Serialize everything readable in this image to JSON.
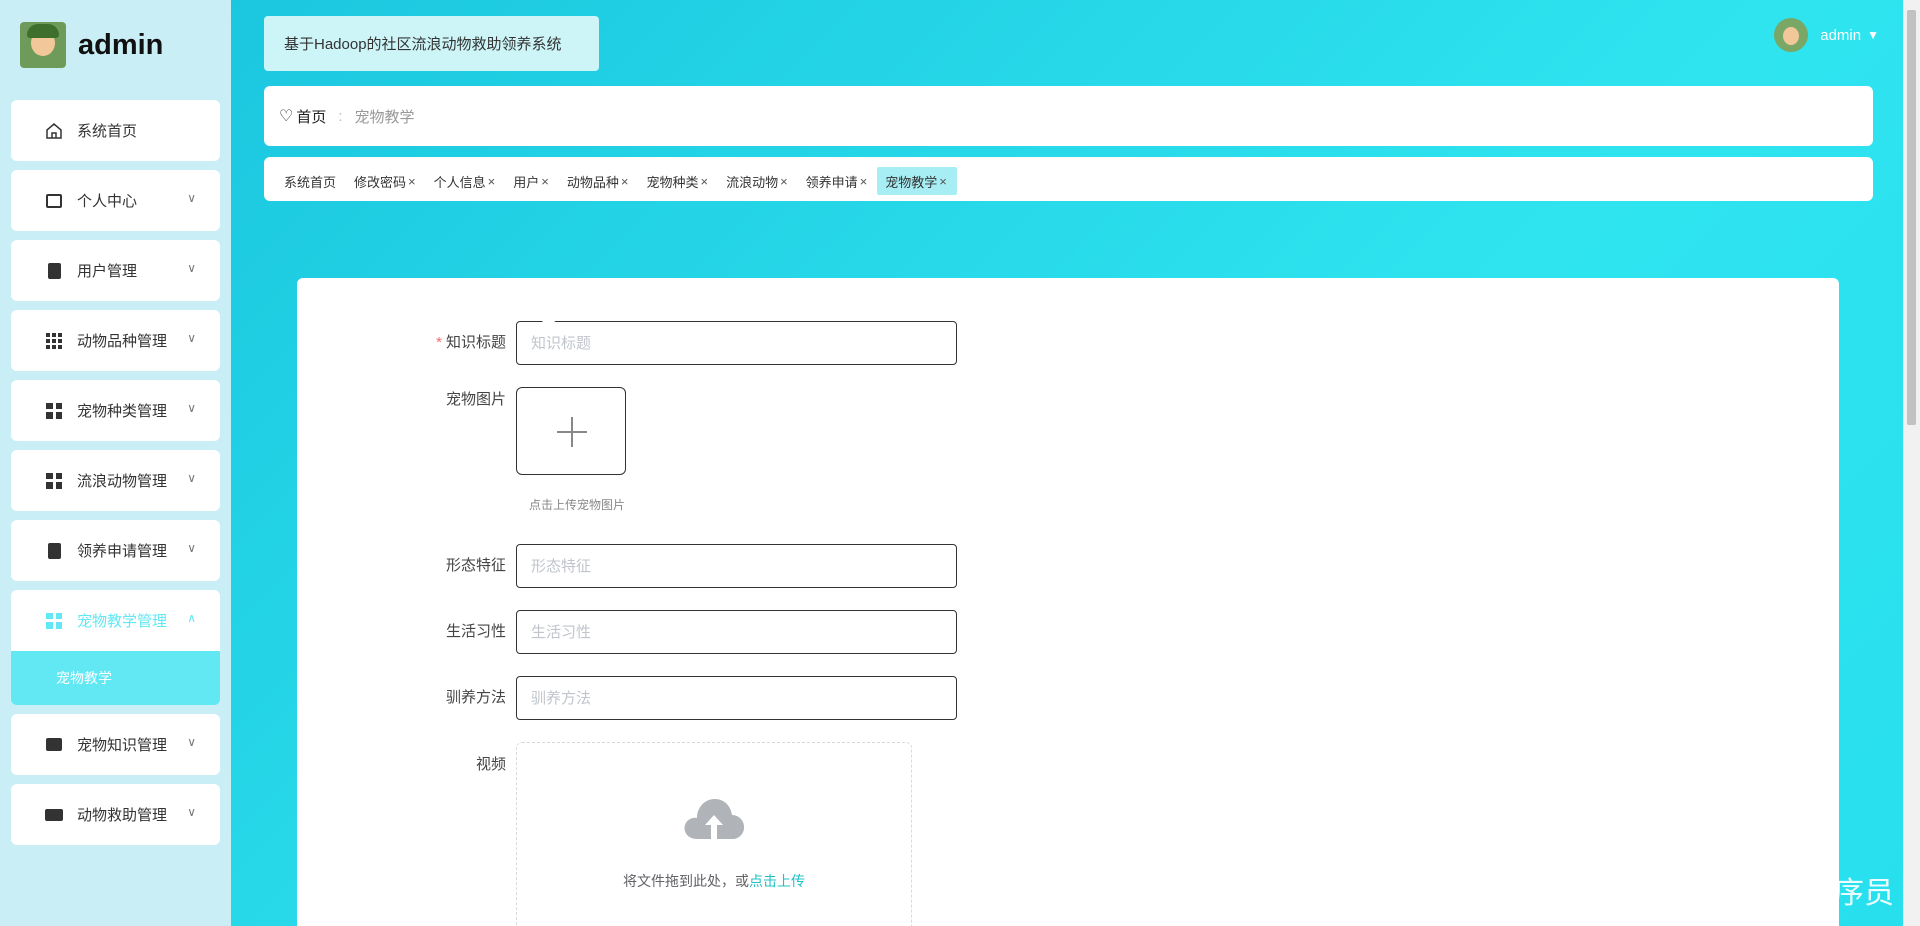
{
  "brand": {
    "name": "admin"
  },
  "sidebar": {
    "items": [
      {
        "label": "系统首页",
        "icon": "home-icon",
        "has_chevron": false
      },
      {
        "label": "个人中心",
        "icon": "card-icon",
        "has_chevron": true
      },
      {
        "label": "用户管理",
        "icon": "clipboard-icon",
        "has_chevron": true
      },
      {
        "label": "动物品种管理",
        "icon": "grid-icon",
        "has_chevron": true
      },
      {
        "label": "宠物种类管理",
        "icon": "grid-icon",
        "has_chevron": true
      },
      {
        "label": "流浪动物管理",
        "icon": "grid-icon",
        "has_chevron": true
      },
      {
        "label": "领养申请管理",
        "icon": "clipboard-icon",
        "has_chevron": true
      },
      {
        "label": "宠物教学管理",
        "icon": "grid-icon",
        "has_chevron": true,
        "active": true
      },
      {
        "label": "宠物知识管理",
        "icon": "wallet-icon",
        "has_chevron": true
      },
      {
        "label": "动物救助管理",
        "icon": "ticket-icon",
        "has_chevron": true
      }
    ],
    "submenu_active": "宠物教学",
    "active_color": "#62e8f3"
  },
  "header": {
    "system_title": "基于Hadoop的社区流浪动物救助领养系统",
    "user_name": "admin"
  },
  "breadcrumb": {
    "home": "首页",
    "current": "宠物教学"
  },
  "tabs": [
    {
      "label": "系统首页",
      "closable": false
    },
    {
      "label": "修改密码",
      "closable": true
    },
    {
      "label": "个人信息",
      "closable": true
    },
    {
      "label": "用户",
      "closable": true
    },
    {
      "label": "动物品种",
      "closable": true
    },
    {
      "label": "宠物种类",
      "closable": true
    },
    {
      "label": "流浪动物",
      "closable": true
    },
    {
      "label": "领养申请",
      "closable": true
    },
    {
      "label": "宠物教学",
      "closable": true,
      "active": true
    }
  ],
  "form": {
    "title_label": "知识标题",
    "title_placeholder": "知识标题",
    "image_label": "宠物图片",
    "image_hint": "点击上传宠物图片",
    "features_label": "形态特征",
    "features_placeholder": "形态特征",
    "habits_label": "生活习性",
    "habits_placeholder": "生活习性",
    "training_label": "驯养方法",
    "training_placeholder": "驯养方法",
    "video_label": "视频",
    "drop_text": "将文件拖到此处，或",
    "drop_link": "点击上传"
  },
  "watermark": "CSDN @毕业程序员"
}
